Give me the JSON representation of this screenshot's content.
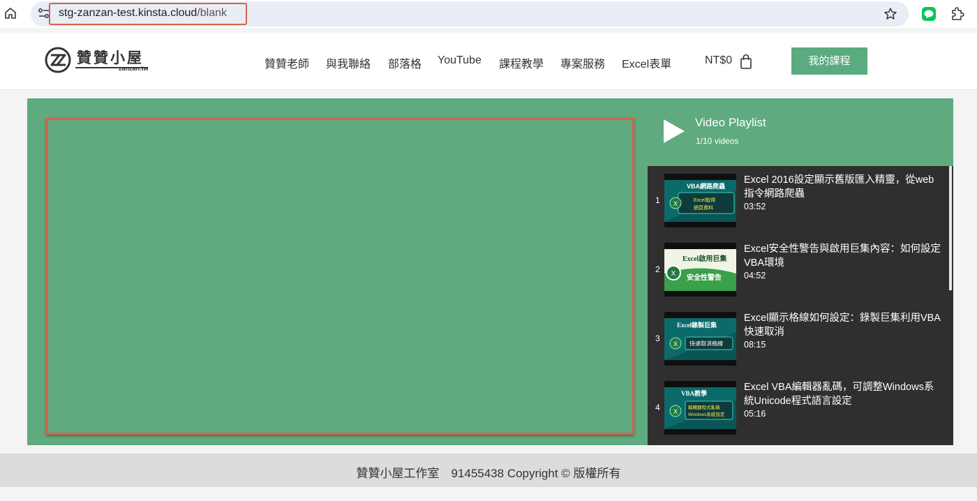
{
  "browser": {
    "url_host": "stg-zanzan-test.kinsta.cloud",
    "url_path": "/blank",
    "icons": [
      "home-icon",
      "site-info-icon",
      "star-icon",
      "line-extension-icon",
      "extensions-icon"
    ]
  },
  "site": {
    "logo_title": "贊贊小屋",
    "logo_sub": "zanzan.tw",
    "nav": [
      "贊贊老師",
      "與我聯絡",
      "部落格",
      "YouTube",
      "課程教學",
      "專案服務",
      "Excel表單"
    ],
    "cart_total": "NT$0",
    "my_courses": "我的課程",
    "colors": {
      "accent_green": "#5aab7f",
      "highlight_red": "#d9614a",
      "playlist_bg": "#2f2f2f"
    }
  },
  "playlist": {
    "title": "Video Playlist",
    "count": "1/10 videos",
    "items": [
      {
        "num": "1",
        "title": "Excel 2016設定顯示舊版匯入精靈，從web指令網路爬蟲",
        "duration": "03:52",
        "thumb_lines": [
          "VBA網路爬蟲",
          "Excel取得",
          "網頁資料"
        ]
      },
      {
        "num": "2",
        "title": "Excel安全性警告與啟用巨集內容：如何設定VBA環境",
        "duration": "04:52",
        "thumb_lines": [
          "Excel啟用巨集",
          "安全性警告"
        ]
      },
      {
        "num": "3",
        "title": "Excel顯示格線如何設定：錄製巨集利用VBA快速取消",
        "duration": "08:15",
        "thumb_lines": [
          "Excel錄製巨集",
          "快速取消格線"
        ]
      },
      {
        "num": "4",
        "title": "Excel VBA編輯器亂碼，可調整Windows系統Unicode程式語言設定",
        "duration": "05:16",
        "thumb_lines": [
          "VBA教學",
          "編輯器程式亂碼",
          "Windows系統設定"
        ]
      }
    ]
  },
  "footer": {
    "text": "贊贊小屋工作室　91455438 Copyright © 版權所有"
  }
}
